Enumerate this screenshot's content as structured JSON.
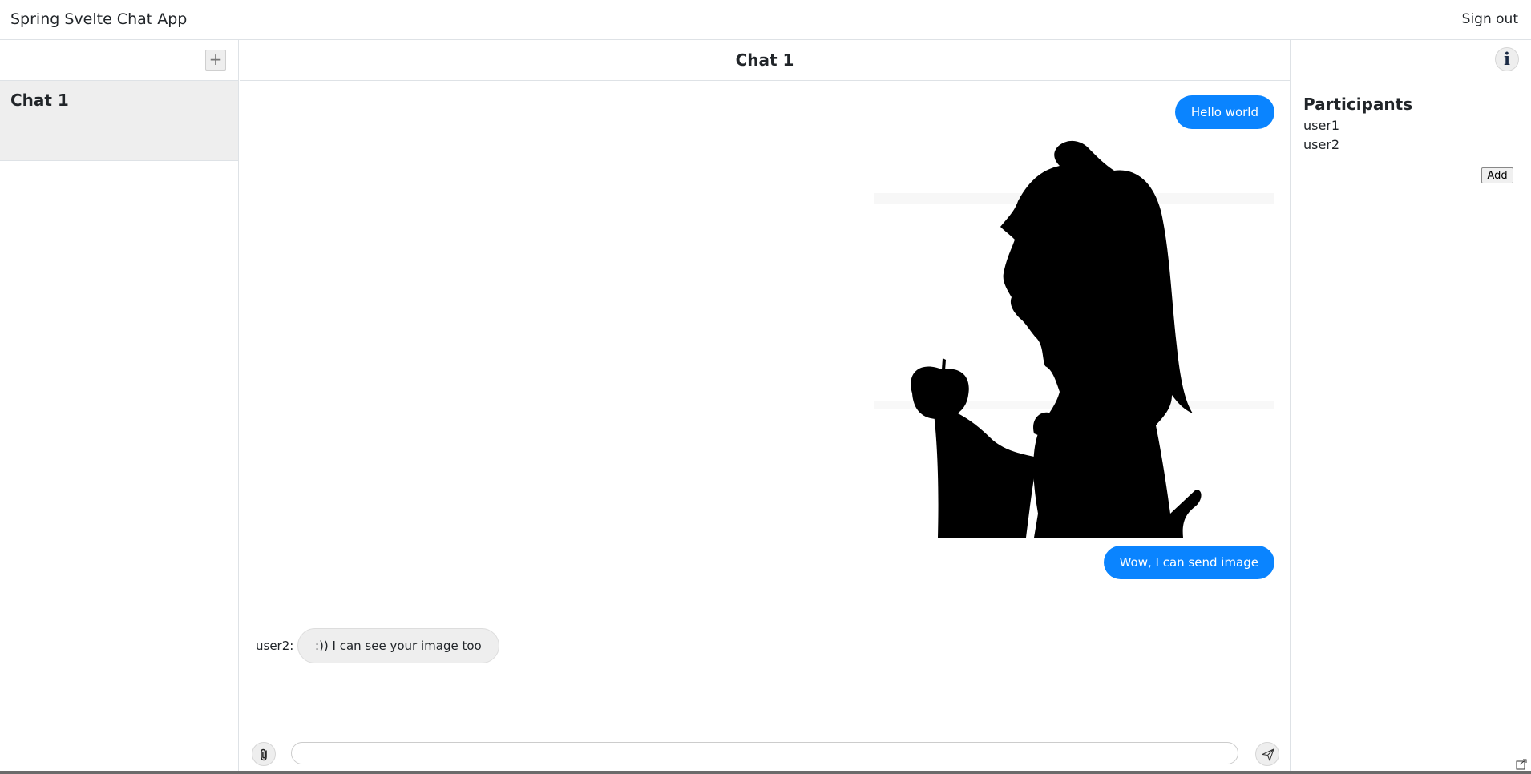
{
  "app": {
    "title": "Spring Svelte Chat App",
    "sign_out": "Sign out"
  },
  "sidebar": {
    "new_chat": "+",
    "chats": [
      {
        "title": "Chat 1"
      }
    ]
  },
  "chat": {
    "title": "Chat 1",
    "info_icon": "i",
    "messages": [
      {
        "from": "me",
        "type": "text",
        "text": "Hello world"
      },
      {
        "from": "me",
        "type": "image",
        "image": "silhouette of a girl holding an apple"
      },
      {
        "from": "me",
        "type": "text",
        "text": "Wow, I can send image"
      },
      {
        "from": "other",
        "type": "text",
        "sender": "user2:",
        "text": ":)) I can see your image too"
      }
    ]
  },
  "composer": {
    "attach_icon": "paperclip-icon",
    "send_icon": "paper-plane-icon",
    "value": "",
    "placeholder": ""
  },
  "participants": {
    "title": "Participants",
    "users": [
      "user1",
      "user2"
    ],
    "add_label": "Add",
    "add_value": ""
  },
  "colors": {
    "own_bubble": "#0a84ff",
    "other_bubble": "#eeeeee",
    "selected_chat": "#eeeeee",
    "border": "#dee2e6"
  }
}
